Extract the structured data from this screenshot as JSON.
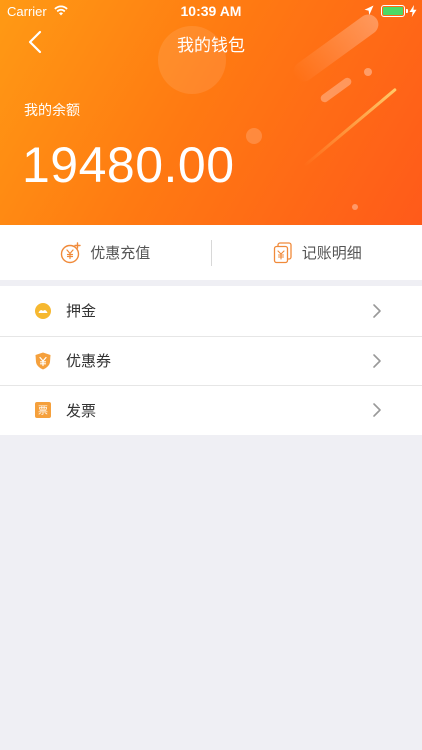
{
  "status_bar": {
    "carrier": "Carrier",
    "time": "10:39 AM"
  },
  "header": {
    "title": "我的钱包",
    "balance_label": "我的余额",
    "balance": "19480.00",
    "gradient_colors": [
      "#ff9a14",
      "#ff5a1a"
    ]
  },
  "actions": [
    {
      "label": "优惠充值",
      "icon": "yen-coin-plus-icon"
    },
    {
      "label": "记账明细",
      "icon": "yen-receipt-icon"
    }
  ],
  "menu": [
    {
      "label": "押金",
      "icon": "deposit-icon"
    },
    {
      "label": "优惠券",
      "icon": "coupon-shield-icon"
    },
    {
      "label": "发票",
      "icon": "invoice-icon",
      "icon_text": "票"
    }
  ],
  "colors": {
    "accent": "#ff7a12",
    "icon_yellow": "#f6b830",
    "icon_orange": "#f5a03c",
    "page_background": "#efeff4"
  }
}
